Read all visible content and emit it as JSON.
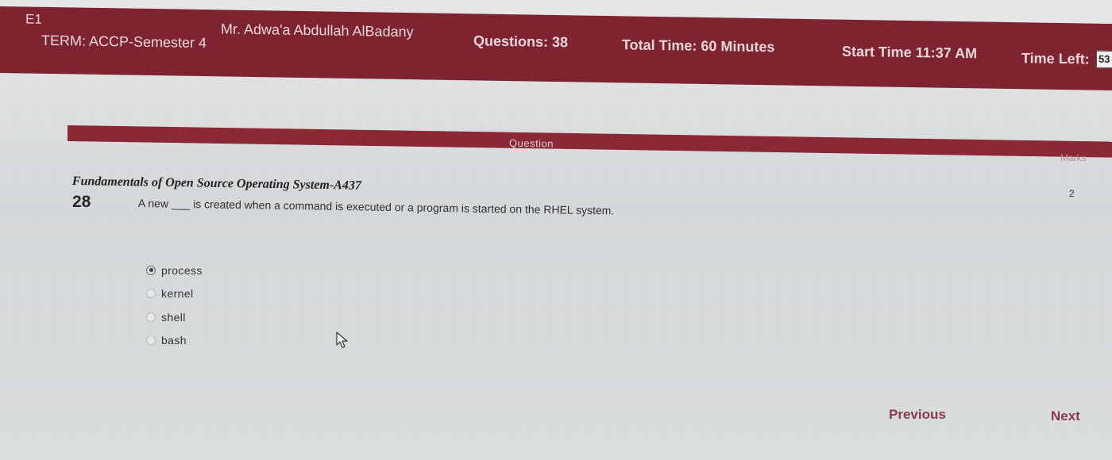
{
  "header": {
    "exam_code": "E1",
    "term": "TERM: ACCP-Semester 4",
    "teacher": "Mr. Adwa'a Abdullah AlBadany",
    "questions": "Questions:  38",
    "total_time": "Total Time:  60 Minutes",
    "start_time": "Start Time  11:37 AM",
    "time_left_label": "Time Left:",
    "time_left_value": "53"
  },
  "question_bar": {
    "label": "Question",
    "marks_label": "Marks"
  },
  "question": {
    "subject": "Fundamentals of Open Source Operating System-A437",
    "number": "28",
    "text": "A new ___ is created when a command is executed or a program is started on the RHEL system.",
    "marks": "2",
    "options": [
      {
        "label": "process",
        "selected": true
      },
      {
        "label": "kernel",
        "selected": false
      },
      {
        "label": "shell",
        "selected": false
      },
      {
        "label": "bash",
        "selected": false
      }
    ]
  },
  "navigation": {
    "previous_label": "Previous",
    "next_label": "Next"
  },
  "colors": {
    "header_bg": "#7e2430",
    "question_bar_bg": "#8a2836",
    "nav_text": "#8a3a44"
  }
}
